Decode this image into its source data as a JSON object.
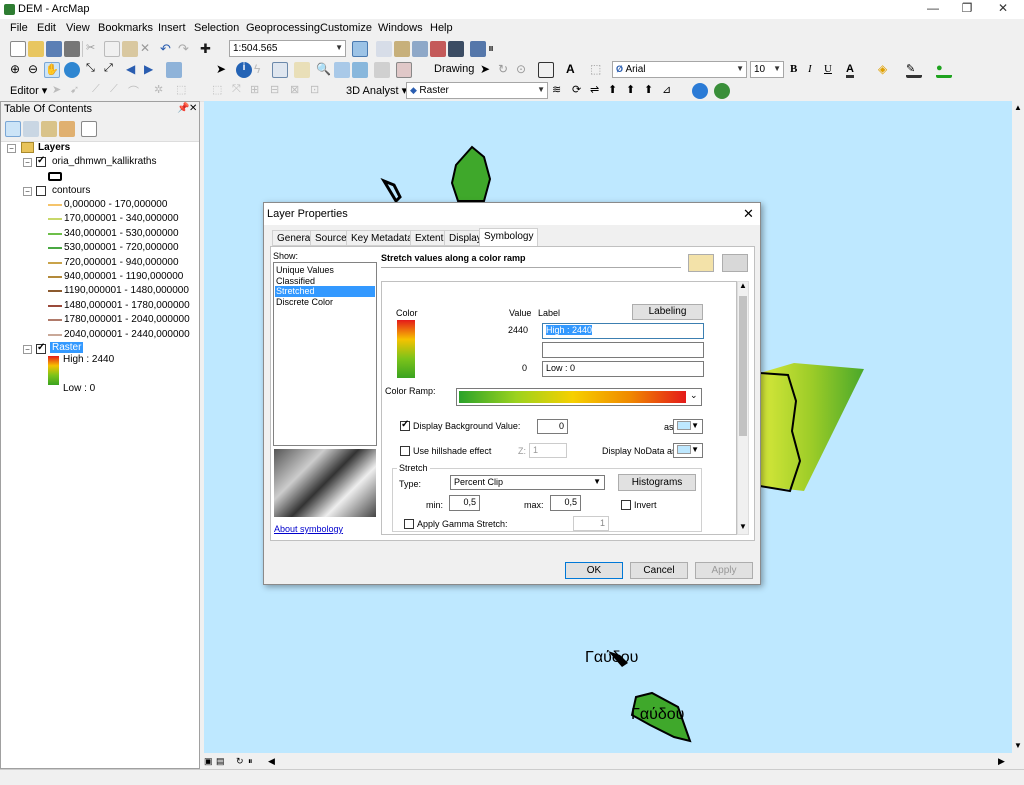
{
  "window": {
    "title": "DEM - ArcMap",
    "minimize": "—",
    "restore": "❐",
    "close": "✕"
  },
  "menu": [
    "File",
    "Edit",
    "View",
    "Bookmarks",
    "Insert",
    "Selection",
    "Geoprocessing",
    "Customize",
    "Windows",
    "Help"
  ],
  "toolbar": {
    "scale": "1:504.565",
    "drawing_label": "Drawing",
    "font_name": "Arial",
    "font_size": "10",
    "bold": "B",
    "italic": "I",
    "underline": "U",
    "text_color": "A",
    "editor_label": "Editor",
    "analyst_label": "3D Analyst",
    "layer_combo": "Raster"
  },
  "toc": {
    "title": "Table Of Contents",
    "root": "Layers",
    "layer1": {
      "name": "oria_dhmwn_kallikraths",
      "checked": true
    },
    "contours": {
      "name": "contours",
      "checked": false,
      "classes": [
        {
          "label": "0,000000 - 170,000000",
          "color": "#f5c46b"
        },
        {
          "label": "170,000001 - 340,000000",
          "color": "#c8d86a"
        },
        {
          "label": "340,000001 - 530,000000",
          "color": "#6dbf4a"
        },
        {
          "label": "530,000001 - 720,000000",
          "color": "#4aa843"
        },
        {
          "label": "720,000001 - 940,000000",
          "color": "#c9a34a"
        },
        {
          "label": "940,000001 - 1190,000000",
          "color": "#b38a3a"
        },
        {
          "label": "1190,000001 - 1480,000000",
          "color": "#8c5a2e"
        },
        {
          "label": "1480,000001 - 1780,000000",
          "color": "#9a4a3a"
        },
        {
          "label": "1780,000001 - 2040,000000",
          "color": "#b07a6a"
        },
        {
          "label": "2040,000001 - 2440,000000",
          "color": "#c9a898"
        }
      ]
    },
    "raster": {
      "name": "Raster",
      "checked": true,
      "high": "High : 2440",
      "low": "Low : 0"
    }
  },
  "map": {
    "labels": [
      "Γαύδου",
      "Γαύδου"
    ]
  },
  "dialog": {
    "title": "Layer Properties",
    "tabs": [
      "General",
      "Source",
      "Key Metadata",
      "Extent",
      "Display",
      "Symbology"
    ],
    "active_tab": "Symbology",
    "show_label": "Show:",
    "show_items": [
      "Unique Values",
      "Classified",
      "Stretched",
      "Discrete Color"
    ],
    "selected_show": "Stretched",
    "heading": "Stretch values along a color ramp",
    "col_color": "Color",
    "col_value": "Value",
    "col_label": "Label",
    "labeling_btn": "Labeling",
    "value_high": "2440",
    "value_low": "0",
    "label_high": "High : 2440",
    "label_mid": "",
    "label_low": "Low : 0",
    "color_ramp_label": "Color Ramp:",
    "display_bg_label": "Display Background Value:",
    "display_bg_checked": true,
    "display_bg_value": "0",
    "as_label": "as",
    "hillshade_label": "Use hillshade effect",
    "hillshade_checked": false,
    "z_label": "Z:",
    "z_value": "1",
    "nodata_label": "Display NoData as",
    "stretch_group": "Stretch",
    "type_label": "Type:",
    "type_value": "Percent Clip",
    "histograms_btn": "Histograms",
    "min_label": "min:",
    "min_value": "0,5",
    "max_label": "max:",
    "max_value": "0,5",
    "invert_label": "Invert",
    "gamma_label": "Apply Gamma Stretch:",
    "gamma_value": "1",
    "about_link": "About symbology",
    "ok": "OK",
    "cancel": "Cancel",
    "apply": "Apply",
    "close": "✕"
  }
}
